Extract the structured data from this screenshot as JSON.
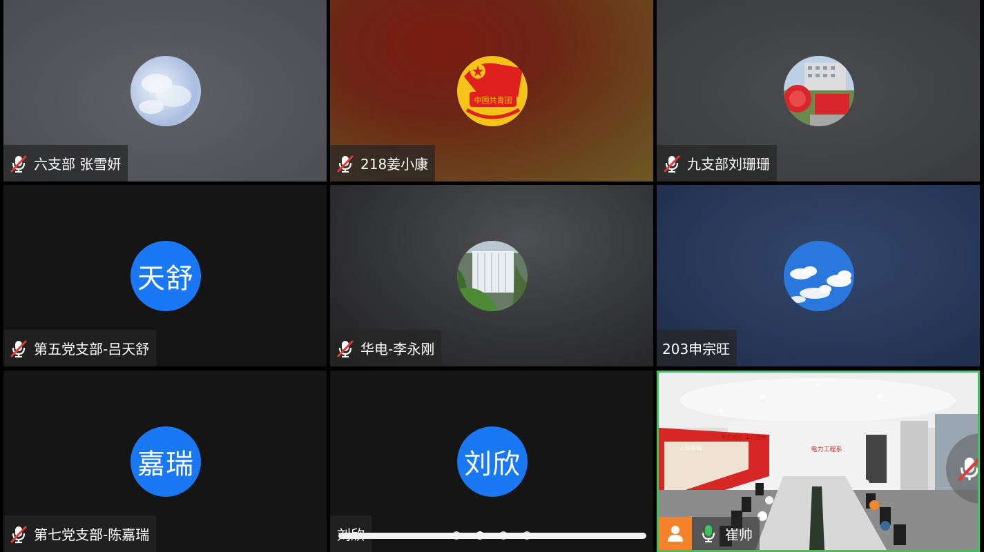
{
  "participants": [
    {
      "name": "六支部 张雪妍",
      "muted": true,
      "avatar": "sky-photo"
    },
    {
      "name": "218姜小康",
      "muted": true,
      "avatar": "youth-league-emblem"
    },
    {
      "name": "九支部刘珊珊",
      "muted": true,
      "avatar": "campus-photo"
    },
    {
      "name": "第五党支部-吕天舒",
      "muted": true,
      "avatar_initials": "天舒"
    },
    {
      "name": "华电-李永刚",
      "muted": true,
      "avatar": "waterfall-photo"
    },
    {
      "name": "203申宗旺",
      "muted": false,
      "avatar": "blue-sky-clouds-photo"
    },
    {
      "name": "第七党支部-陈嘉瑞",
      "muted": true,
      "avatar_initials": "嘉瑞"
    },
    {
      "name": "刘欣",
      "muted": false,
      "avatar_initials": "刘欣"
    },
    {
      "name": "崔帅",
      "muted": false,
      "speaking": true,
      "video": "conference-room-video"
    }
  ],
  "emblem_text": "中国共青团",
  "room": {
    "wall_sign": "电力工程系",
    "banner": "入党誓词",
    "slogan": "不忘初心 牢记使命"
  },
  "pager": {
    "pages": 4,
    "active": 2
  },
  "colors": {
    "accent_blue": "#1a78f5",
    "active_border": "#35c85a",
    "mic_green": "#35c85a",
    "avatar_orange": "#f5822a"
  }
}
